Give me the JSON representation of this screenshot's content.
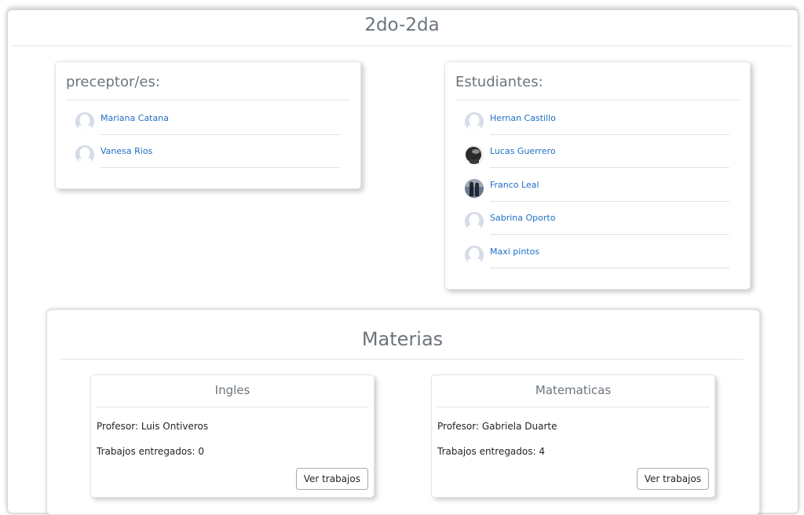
{
  "page": {
    "title": "2do-2da"
  },
  "preceptores": {
    "title": "preceptor/es:",
    "items": [
      {
        "name": "Mariana Catana",
        "avatar": "default"
      },
      {
        "name": "Vanesa Rios",
        "avatar": "default"
      }
    ]
  },
  "estudiantes": {
    "title": "Estudiantes:",
    "items": [
      {
        "name": "Hernan Castillo",
        "avatar": "default"
      },
      {
        "name": "Lucas Guerrero",
        "avatar": "photo"
      },
      {
        "name": "Franco Leal",
        "avatar": "photo"
      },
      {
        "name": "Sabrina Oporto",
        "avatar": "default"
      },
      {
        "name": "Maxi pintos",
        "avatar": "default"
      }
    ]
  },
  "materias": {
    "title": "Materias",
    "subjects": [
      {
        "name": "Ingles",
        "profesor": "Profesor: Luis Ontiveros",
        "trabajos": "Trabajos entregados: 0",
        "button": "Ver trabajos"
      },
      {
        "name": "Matematicas",
        "profesor": "Profesor: Gabriela Duarte",
        "trabajos": "Trabajos entregados: 4",
        "button": "Ver trabajos"
      }
    ]
  },
  "colors": {
    "link": "#1f6fc5",
    "muted_title": "#6c757d",
    "avatar_default": "#d6dce8"
  }
}
